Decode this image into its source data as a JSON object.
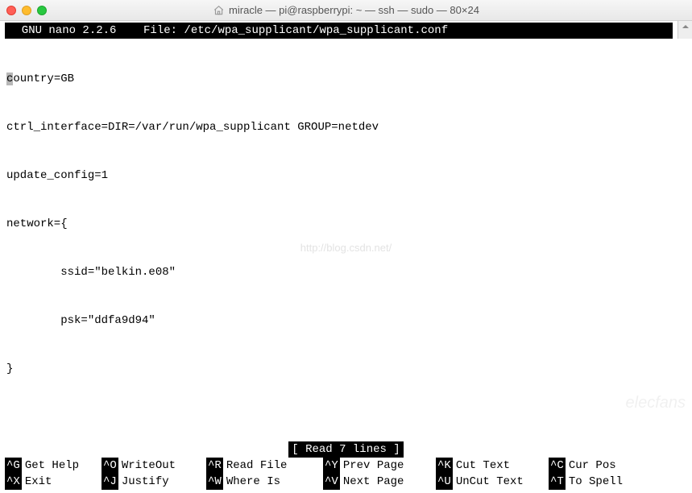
{
  "window": {
    "title": "miracle — pi@raspberrypi: ~ — ssh — sudo — 80×24"
  },
  "nano": {
    "header": "  GNU nano 2.2.6    File: /etc/wpa_supplicant/wpa_supplicant.conf             ",
    "status": "[ Read 7 lines ]"
  },
  "file": {
    "cursor_char": "c",
    "line1_rest": "ountry=GB",
    "line2": "ctrl_interface=DIR=/var/run/wpa_supplicant GROUP=netdev",
    "line3": "update_config=1",
    "line4": "network={",
    "line5": "        ssid=\"belkin.e08\"",
    "line6": "        psk=\"ddfa9d94\"",
    "line7": "}"
  },
  "watermark": "http://blog.csdn.net/",
  "corner_watermark": "elecfans",
  "shortcuts": {
    "row1": [
      {
        "key": "^G",
        "label": "Get Help"
      },
      {
        "key": "^O",
        "label": "WriteOut"
      },
      {
        "key": "^R",
        "label": "Read File"
      },
      {
        "key": "^Y",
        "label": "Prev Page"
      },
      {
        "key": "^K",
        "label": "Cut Text"
      },
      {
        "key": "^C",
        "label": "Cur Pos"
      }
    ],
    "row2": [
      {
        "key": "^X",
        "label": "Exit"
      },
      {
        "key": "^J",
        "label": "Justify"
      },
      {
        "key": "^W",
        "label": "Where Is"
      },
      {
        "key": "^V",
        "label": "Next Page"
      },
      {
        "key": "^U",
        "label": "UnCut Text"
      },
      {
        "key": "^T",
        "label": "To Spell"
      }
    ]
  }
}
